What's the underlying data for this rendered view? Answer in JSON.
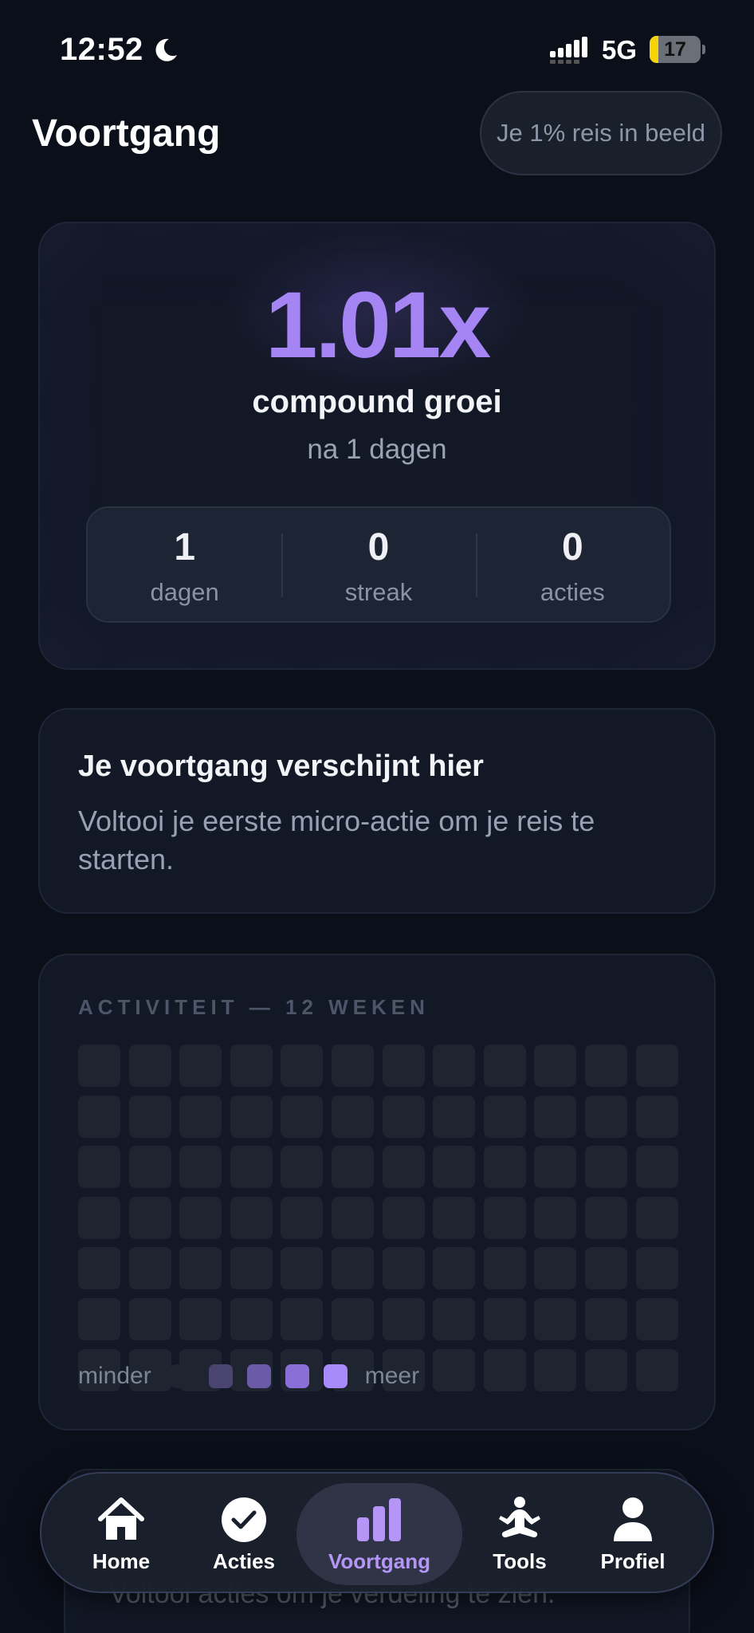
{
  "status_bar": {
    "time": "12:52",
    "network": "5G",
    "battery": "17"
  },
  "header": {
    "title": "Voortgang",
    "journey_button": "Je 1% reis in beeld"
  },
  "growth": {
    "value": "1.01x",
    "label": "compound groei",
    "subtitle": "na 1 dagen",
    "stats": [
      {
        "value": "1",
        "label": "dagen"
      },
      {
        "value": "0",
        "label": "streak"
      },
      {
        "value": "0",
        "label": "acties"
      }
    ]
  },
  "empty_state": {
    "title": "Je voortgang verschijnt hier",
    "text": "Voltooi je eerste micro-actie om je reis te starten."
  },
  "activity": {
    "heading": "ACTIVITEIT — 12 WEKEN",
    "weeks": 12,
    "days_per_week": 7,
    "legend_less": "minder",
    "legend_more": "meer",
    "legend_colors": [
      "#1f2431",
      "#4a4470",
      "#6a5aa8",
      "#8a6fd6",
      "#a78bfa"
    ]
  },
  "hidden_card_text": "Voltooi acties om je verdeling te zien.",
  "tabs": [
    {
      "label": "Home",
      "icon": "home-icon",
      "active": false
    },
    {
      "label": "Acties",
      "icon": "check-circle-icon",
      "active": false
    },
    {
      "label": "Voortgang",
      "icon": "bar-chart-icon",
      "active": true
    },
    {
      "label": "Tools",
      "icon": "meditation-icon",
      "active": false
    },
    {
      "label": "Profiel",
      "icon": "person-icon",
      "active": false
    }
  ],
  "colors": {
    "accent": "#a585f4",
    "background": "#0b0f1a",
    "card": "#121826"
  }
}
